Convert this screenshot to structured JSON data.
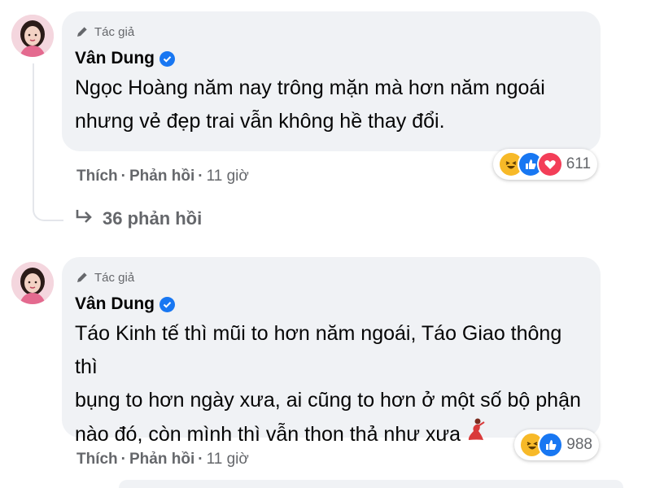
{
  "comments": [
    {
      "author_badge": "Tác giả",
      "name": "Vân Dung",
      "text_lines": [
        "Ngọc Hoàng năm nay trông mặn mà hơn năm ngoái",
        "nhưng vẻ đẹp trai vẫn không hề thay đổi."
      ],
      "like_label": "Thích",
      "reply_label": "Phản hồi",
      "time": "11 giờ",
      "separator": "·",
      "reaction_icons": [
        "haha-icon",
        "like-icon",
        "love-icon"
      ],
      "reaction_count": "611",
      "replies_label": "36 phản hồi"
    },
    {
      "author_badge": "Tác giả",
      "name": "Vân Dung",
      "text_lines": [
        "Táo Kinh tế thì mũi to hơn năm ngoái, Táo Giao thông thì",
        "bụng to hơn ngày xưa, ai cũng to hơn ở một số bộ phận",
        "nào đó, còn mình thì vẫn thon thả như xưa"
      ],
      "inline_emoji": "dancer-emoji",
      "like_label": "Thích",
      "reply_label": "Phản hồi",
      "time": "11 giờ",
      "separator": "·",
      "reaction_icons": [
        "haha-icon",
        "like-icon"
      ],
      "reaction_count": "988"
    }
  ],
  "colors": {
    "bubble": "#f0f2f5",
    "secondary_text": "#65676b",
    "verified": "#1877f2",
    "haha": "#f7b928",
    "love": "#f33e58"
  }
}
